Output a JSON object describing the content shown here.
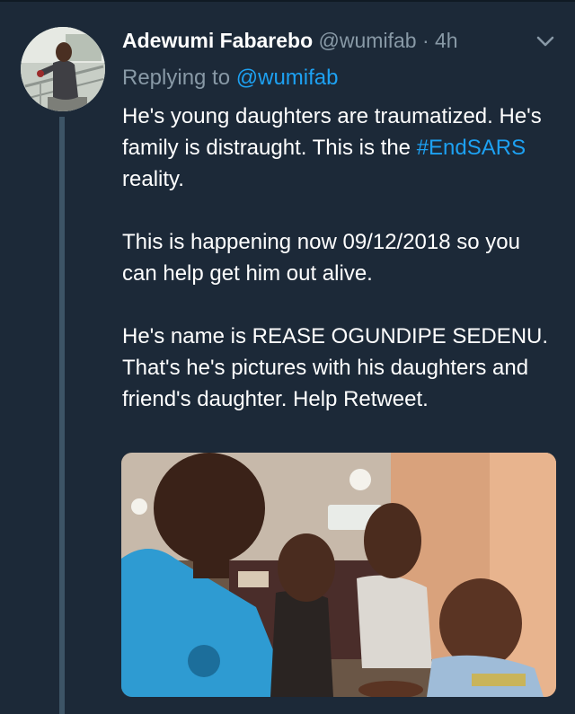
{
  "tweet": {
    "author_name": "Adewumi Fabarebo",
    "author_handle": "@wumifab",
    "separator": "·",
    "time": "4h",
    "replying_label": "Replying to",
    "replying_to": "@wumifab",
    "para1_a": "He's young daughters are traumatized. He's family is distraught. This is the",
    "hashtag": "#EndSARS",
    "para1_b": "reality.",
    "para2": "This is happening now 09/12/2018 so you can help get him out alive.",
    "para3": "He's name is REASE OGUNDIPE SEDENU. That's he's pictures with his daughters and friend's daughter. Help Retweet."
  },
  "icons": {
    "menu": "chevron-down-icon"
  },
  "colors": {
    "background": "#1c2938",
    "link": "#1da1f2",
    "muted": "#8899a6"
  }
}
